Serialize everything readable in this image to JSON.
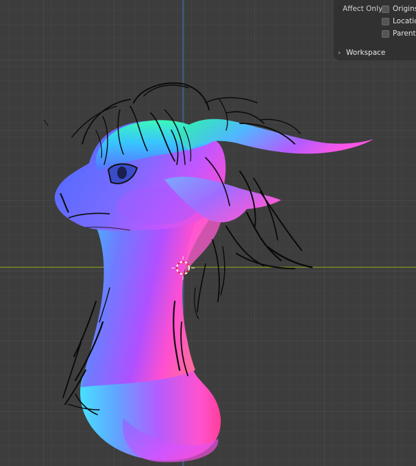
{
  "options": {
    "affect_only_label": "Affect Only",
    "items": [
      {
        "label": "Origins",
        "checked": false
      },
      {
        "label": "Locations",
        "checked": false
      },
      {
        "label": "Parents",
        "checked": false
      }
    ],
    "workspace_label": "Workspace"
  },
  "colors": {
    "viewport_bg": "#3d3d3d",
    "x_axis": "#7e9c1f",
    "z_axis": "#3a6fb3",
    "cursor_white": "#ffffff",
    "cursor_red": "#d9322f"
  },
  "icons": {
    "workspace_toggle": "chevron-right-icon",
    "3d_cursor": "crosshair-target-icon"
  }
}
